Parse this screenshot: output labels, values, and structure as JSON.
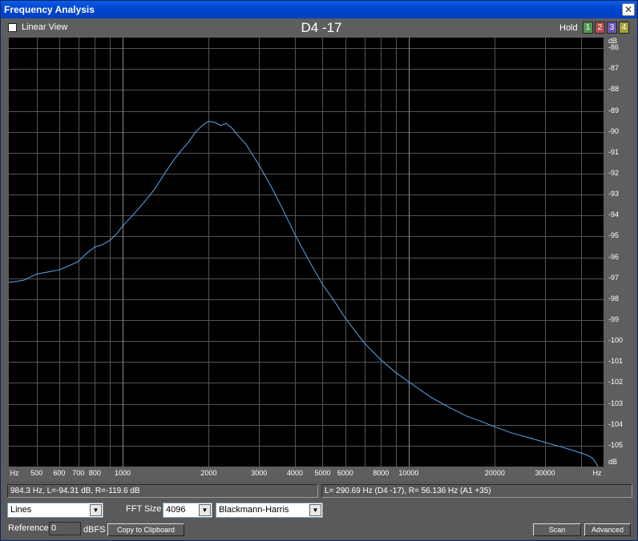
{
  "window": {
    "title": "Frequency Analysis",
    "close_icon": "close-icon"
  },
  "toolbar": {
    "linear_view_label": "Linear View",
    "linear_view_checked": false,
    "note": "D4 -17",
    "hold_label": "Hold",
    "hold_buttons": [
      {
        "label": "1",
        "color": "#4e9a4e"
      },
      {
        "label": "2",
        "color": "#b44e4e"
      },
      {
        "label": "3",
        "color": "#6a58b0"
      },
      {
        "label": "4",
        "color": "#a8a03c"
      }
    ]
  },
  "axes": {
    "y_unit_top": "dB",
    "y_unit_bottom": "dB",
    "x_unit_left": "Hz",
    "x_unit_right": "Hz"
  },
  "chart_data": {
    "type": "line",
    "xscale": "log",
    "xlim": [
      400,
      48000
    ],
    "ylim": [
      -106,
      -85.5
    ],
    "y_ticks": [
      -86,
      -87,
      -88,
      -89,
      -90,
      -91,
      -92,
      -93,
      -94,
      -95,
      -96,
      -97,
      -98,
      -99,
      -100,
      -101,
      -102,
      -103,
      -104,
      -105
    ],
    "x_ticks": [
      {
        "v": 500,
        "label": "500",
        "major": false
      },
      {
        "v": 600,
        "label": "600",
        "major": false
      },
      {
        "v": 700,
        "label": "700",
        "major": false
      },
      {
        "v": 800,
        "label": "800",
        "major": false
      },
      {
        "v": 900,
        "label": "",
        "major": false
      },
      {
        "v": 1000,
        "label": "1000",
        "major": true
      },
      {
        "v": 2000,
        "label": "2000",
        "major": false
      },
      {
        "v": 3000,
        "label": "3000",
        "major": false
      },
      {
        "v": 4000,
        "label": "4000",
        "major": false
      },
      {
        "v": 5000,
        "label": "5000",
        "major": false
      },
      {
        "v": 6000,
        "label": "6000",
        "major": false
      },
      {
        "v": 7000,
        "label": "",
        "major": false
      },
      {
        "v": 8000,
        "label": "8000",
        "major": false
      },
      {
        "v": 9000,
        "label": "",
        "major": false
      },
      {
        "v": 10000,
        "label": "10000",
        "major": true
      },
      {
        "v": 20000,
        "label": "20000",
        "major": false
      },
      {
        "v": 30000,
        "label": "30000",
        "major": false
      },
      {
        "v": 40000,
        "label": "",
        "major": false
      }
    ],
    "series": [
      {
        "color": "#5aa8f0",
        "points": [
          [
            400,
            -97.2
          ],
          [
            450,
            -97.1
          ],
          [
            500,
            -96.8
          ],
          [
            550,
            -96.7
          ],
          [
            600,
            -96.6
          ],
          [
            650,
            -96.4
          ],
          [
            700,
            -96.2
          ],
          [
            750,
            -95.8
          ],
          [
            800,
            -95.5
          ],
          [
            850,
            -95.4
          ],
          [
            900,
            -95.2
          ],
          [
            950,
            -94.9
          ],
          [
            1000,
            -94.5
          ],
          [
            1100,
            -93.9
          ],
          [
            1200,
            -93.3
          ],
          [
            1300,
            -92.7
          ],
          [
            1400,
            -92.0
          ],
          [
            1500,
            -91.4
          ],
          [
            1600,
            -90.9
          ],
          [
            1700,
            -90.5
          ],
          [
            1800,
            -90.0
          ],
          [
            1900,
            -89.7
          ],
          [
            2000,
            -89.5
          ],
          [
            2100,
            -89.55
          ],
          [
            2200,
            -89.7
          ],
          [
            2300,
            -89.6
          ],
          [
            2400,
            -89.8
          ],
          [
            2500,
            -90.1
          ],
          [
            2700,
            -90.6
          ],
          [
            3000,
            -91.6
          ],
          [
            3300,
            -92.6
          ],
          [
            3600,
            -93.6
          ],
          [
            4000,
            -94.9
          ],
          [
            4500,
            -96.2
          ],
          [
            5000,
            -97.3
          ],
          [
            5500,
            -98.1
          ],
          [
            6000,
            -98.9
          ],
          [
            7000,
            -100.1
          ],
          [
            8000,
            -100.9
          ],
          [
            9000,
            -101.5
          ],
          [
            10000,
            -101.95
          ],
          [
            12000,
            -102.7
          ],
          [
            14000,
            -103.2
          ],
          [
            16000,
            -103.6
          ],
          [
            18000,
            -103.85
          ],
          [
            20000,
            -104.1
          ],
          [
            23000,
            -104.4
          ],
          [
            26000,
            -104.6
          ],
          [
            30000,
            -104.85
          ],
          [
            34000,
            -105.05
          ],
          [
            38000,
            -105.25
          ],
          [
            42000,
            -105.45
          ],
          [
            44000,
            -105.6
          ],
          [
            45500,
            -105.9
          ],
          [
            46500,
            -106.2
          ]
        ]
      }
    ]
  },
  "status": {
    "left": "984.3 Hz, L=-94.31 dB, R=-119.6 dB",
    "right": "L= 290.69 Hz (D4 -17), R= 56.136 Hz (A1 +35)"
  },
  "controls": {
    "view_mode": "Lines",
    "fft_size_label": "FFT Size",
    "fft_size": "4096",
    "window_fn": "Blackmann-Harris",
    "reference_label": "Reference",
    "reference_value": "0",
    "reference_unit": "dBFS",
    "copy_button": "Copy to Clipboard",
    "scan_button": "Scan",
    "advanced_button": "Advanced"
  }
}
